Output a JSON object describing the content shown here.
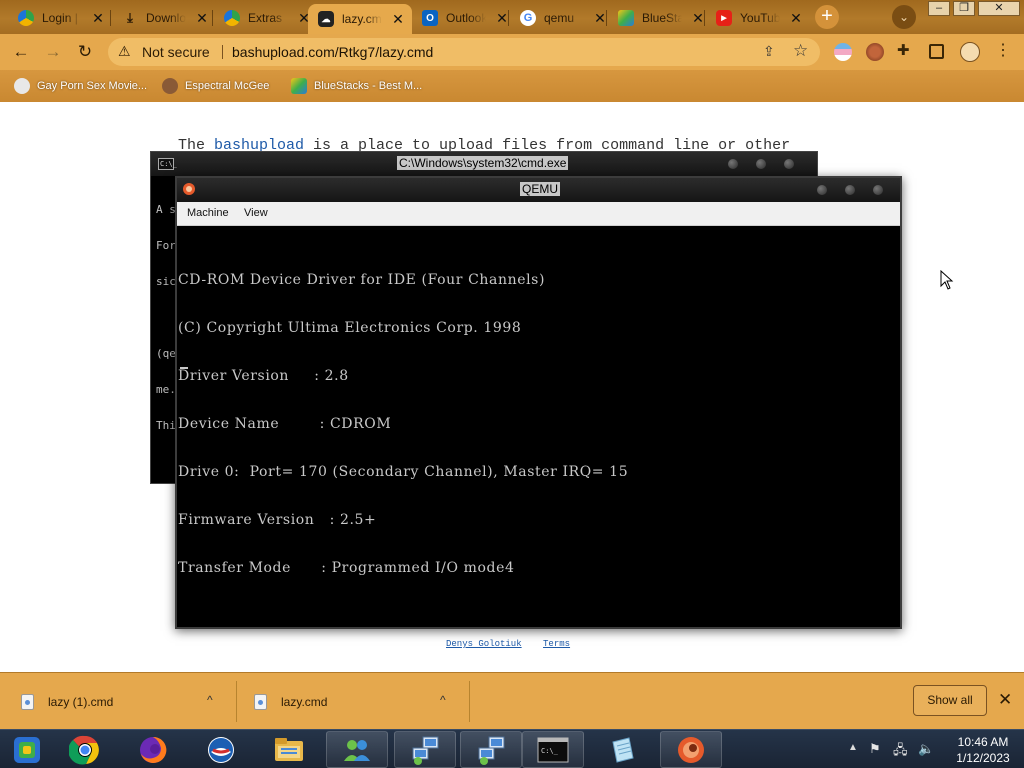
{
  "browser": {
    "tabs": [
      {
        "title": "Login | P",
        "favicon": "edge-icon"
      },
      {
        "title": "Download",
        "favicon": "download-icon"
      },
      {
        "title": "Extras",
        "favicon": "edge-icon"
      },
      {
        "title": "lazy.cmd",
        "favicon": "cloud-upload-icon",
        "active": true
      },
      {
        "title": "Outlook",
        "favicon": "outlook-icon"
      },
      {
        "title": "qemu",
        "favicon": "google-icon"
      },
      {
        "title": "BlueStacks",
        "favicon": "bluestacks-icon"
      },
      {
        "title": "YouTube",
        "favicon": "youtube-icon"
      }
    ],
    "close_glyph": "✕",
    "new_tab_glyph": "+",
    "address": {
      "security_label": "Not secure",
      "url": "bashupload.com/Rtkg7/lazy.cmd"
    },
    "bookmarks": [
      {
        "label": "Gay Porn Sex Movie...",
        "icon": "bookmark-favicon-icon"
      },
      {
        "label": "Espectral McGee",
        "icon": "bookmark-favicon-icon"
      },
      {
        "label": "BlueStacks - Best M...",
        "icon": "bluestacks-icon"
      }
    ]
  },
  "page": {
    "intro_prefix": "The ",
    "intro_link": "bashupload",
    "intro_suffix": " is a place to upload files from command line or other",
    "footer_links": [
      "Denys Golotiuk",
      "Terms"
    ]
  },
  "cmd_window": {
    "title": "C:\\Windows\\system32\\cmd.exe",
    "icon_text": "C:\\_",
    "body_lines": [
      "A s",
      "For",
      "sic",
      "",
      "(qe",
      "me.",
      "Thi"
    ]
  },
  "qemu_window": {
    "title": "QEMU",
    "menu": [
      "Machine",
      "View"
    ],
    "screen_lines": [
      "CD-ROM Device Driver for IDE (Four Channels)",
      "(C) Copyright Ultima Electronics Corp. 1998",
      "Driver Version     : 2.8",
      "Device Name        : CDROM",
      "Drive 0:  Port= 170 (Secondary Channel), Master IRQ= 15",
      "Firmware Version   : 2.5+",
      "Transfer Mode      : Programmed I/O mode4"
    ]
  },
  "downloads": {
    "items": [
      "lazy (1).cmd",
      "lazy.cmd"
    ],
    "chevron_glyph": "^",
    "show_all_label": "Show all",
    "close_glyph": "✕"
  },
  "taskbar": {
    "pinned": [
      "bluestacks-icon",
      "chrome-icon",
      "firefox-icon",
      "opera-icon",
      "file-explorer-icon",
      "people-network-icon",
      "network-setup-icon",
      "network-setup-icon",
      "command-prompt-icon",
      "notepad-icon",
      "qemu-icon"
    ],
    "clock_time": "10:46 AM",
    "clock_date": "1/12/2023"
  },
  "colors": {
    "theme_orange": "#e5a84d",
    "tab_strip": "#a86f22",
    "console_bg": "#000000",
    "console_text": "#c8c8c8",
    "link_blue": "#1e5aa8",
    "taskbar": "#1f2b3d"
  }
}
